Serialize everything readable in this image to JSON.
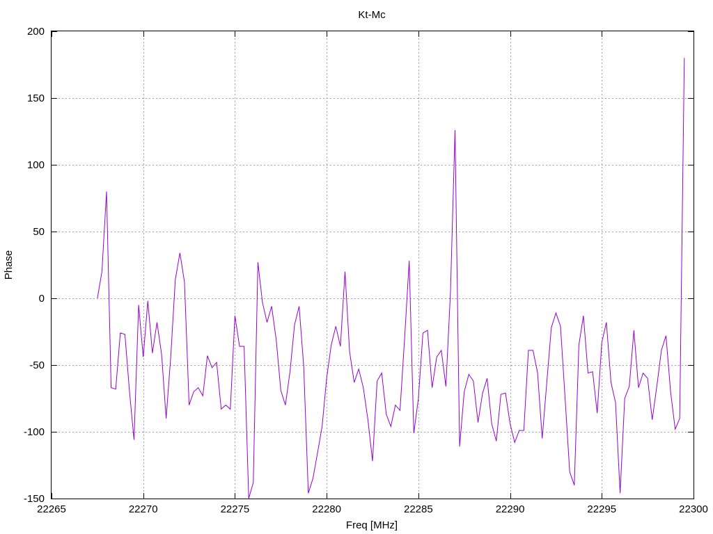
{
  "chart_data": {
    "type": "line",
    "title": "Kt-Mc",
    "xlabel": "Freq [MHz]",
    "ylabel": "Phase",
    "xlim": [
      22265,
      22300
    ],
    "ylim": [
      -150,
      200
    ],
    "xticks": [
      22265,
      22270,
      22275,
      22280,
      22285,
      22290,
      22295,
      22300
    ],
    "yticks": [
      -150,
      -100,
      -50,
      0,
      50,
      100,
      150,
      200
    ],
    "grid": true,
    "series": [
      {
        "color": "#9400d3",
        "x": [
          22267.5,
          22267.75,
          22268.0,
          22268.25,
          22268.5,
          22268.75,
          22269.0,
          22269.25,
          22269.5,
          22269.75,
          22270.0,
          22270.25,
          22270.5,
          22270.75,
          22271.0,
          22271.25,
          22271.5,
          22271.75,
          22272.0,
          22272.25,
          22272.5,
          22272.75,
          22273.0,
          22273.25,
          22273.5,
          22273.75,
          22274.0,
          22274.25,
          22274.5,
          22274.75,
          22275.0,
          22275.25,
          22275.5,
          22275.75,
          22276.0,
          22276.25,
          22276.5,
          22276.75,
          22277.0,
          22277.25,
          22277.5,
          22277.75,
          22278.0,
          22278.25,
          22278.5,
          22278.75,
          22279.0,
          22279.25,
          22279.5,
          22279.75,
          22280.0,
          22280.25,
          22280.5,
          22280.75,
          22281.0,
          22281.25,
          22281.5,
          22281.75,
          22282.0,
          22282.25,
          22282.5,
          22282.75,
          22283.0,
          22283.25,
          22283.5,
          22283.75,
          22284.0,
          22284.25,
          22284.5,
          22284.75,
          22285.0,
          22285.25,
          22285.5,
          22285.75,
          22286.0,
          22286.25,
          22286.5,
          22286.75,
          22287.0,
          22287.25,
          22287.5,
          22287.75,
          22288.0,
          22288.25,
          22288.5,
          22288.75,
          22289.0,
          22289.25,
          22289.5,
          22289.75,
          22290.0,
          22290.25,
          22290.5,
          22290.75,
          22291.0,
          22291.25,
          22291.5,
          22291.75,
          22292.0,
          22292.25,
          22292.5,
          22292.75,
          22293.0,
          22293.25,
          22293.5,
          22293.75,
          22294.0,
          22294.25,
          22294.5,
          22294.75,
          22295.0,
          22295.25,
          22295.5,
          22295.75,
          22296.0,
          22296.25,
          22296.5,
          22296.75,
          22297.0,
          22297.25,
          22297.5,
          22297.75,
          22298.0,
          22298.25,
          22298.5,
          22298.75,
          22299.0,
          22299.25,
          22299.5
        ],
        "y": [
          0,
          20,
          80,
          -67,
          -68,
          -26,
          -27,
          -70,
          -106,
          -5,
          -44,
          -2,
          -41,
          -18,
          -42,
          -90,
          -44,
          14,
          34,
          12,
          -80,
          -70,
          -67,
          -73,
          -43,
          -52,
          -48,
          -83,
          -80,
          -83,
          -13,
          -36,
          -36,
          -150,
          -138,
          27,
          -3,
          -18,
          -6,
          -31,
          -69,
          -80,
          -55,
          -20,
          -6,
          -51,
          -146,
          -135,
          -116,
          -96,
          -60,
          -35,
          -21,
          -36,
          20,
          -40,
          -63,
          -53,
          -67,
          -91,
          -122,
          -62,
          -56,
          -87,
          -96,
          -80,
          -84,
          -30,
          28,
          -101,
          -75,
          -26,
          -24,
          -67,
          -44,
          -39,
          -66,
          5,
          126,
          -111,
          -70,
          -57,
          -62,
          -93,
          -71,
          -60,
          -94,
          -107,
          -72,
          -71,
          -94,
          -108,
          -99,
          -99,
          -39,
          -39,
          -56,
          -105,
          -63,
          -22,
          -11,
          -21,
          -75,
          -130,
          -140,
          -35,
          -13,
          -56,
          -55,
          -86,
          -33,
          -18,
          -63,
          -78,
          -146,
          -75,
          -66,
          -24,
          -67,
          -56,
          -60,
          -91,
          -66,
          -39,
          -28,
          -70,
          -98,
          -90,
          180
        ]
      }
    ]
  }
}
